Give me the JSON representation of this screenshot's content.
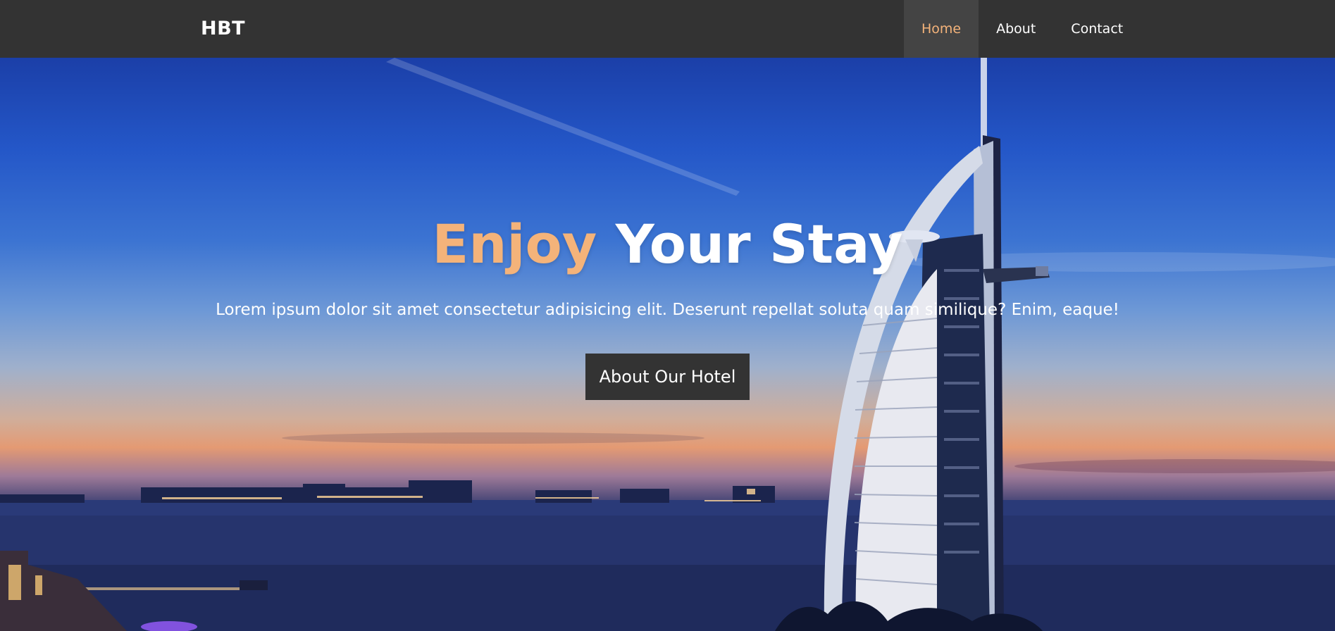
{
  "nav": {
    "brand": "HBT",
    "links": [
      {
        "label": "Home",
        "active": true
      },
      {
        "label": "About",
        "active": false
      },
      {
        "label": "Contact",
        "active": false
      }
    ]
  },
  "hero": {
    "title_accent": "Enjoy",
    "title_rest": "Your Stay",
    "subtitle": "Lorem ipsum dolor sit amet consectetur adipisicing elit. Deserunt repellat soluta quam similique? Enim, eaque!",
    "button_label": "About Our Hotel"
  },
  "colors": {
    "navbar": "#333333",
    "accent": "#f4b37a",
    "text": "#ffffff"
  }
}
